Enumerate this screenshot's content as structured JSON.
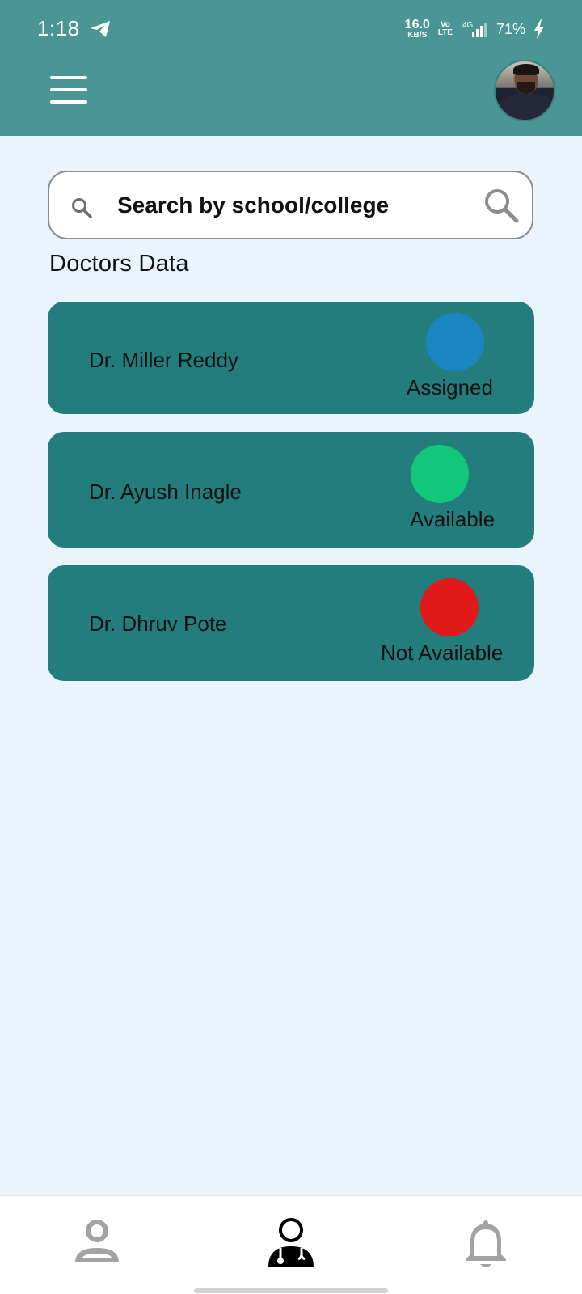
{
  "status_bar": {
    "time": "1:18",
    "speed_value": "16.0",
    "speed_unit": "KB/S",
    "volte_top": "Vo",
    "volte_bottom": "LTE",
    "network": "4G",
    "battery": "71%"
  },
  "search": {
    "placeholder": "Search by school/college"
  },
  "section_title": "Doctors Data",
  "doctors": [
    {
      "name": "Dr. Miller Reddy",
      "status": "Assigned",
      "status_color": "#1a87c2"
    },
    {
      "name": "Dr. Ayush Inagle",
      "status": "Available",
      "status_color": "#13c77a"
    },
    {
      "name": "Dr. Dhruv Pote",
      "status": "Not Available",
      "status_color": "#e01919"
    }
  ],
  "colors": {
    "header": "#4a9696",
    "card": "#247d7d",
    "background": "#eaf4fd"
  },
  "bottom_nav": [
    {
      "icon": "person-icon",
      "active": false
    },
    {
      "icon": "doctor-icon",
      "active": true
    },
    {
      "icon": "bell-icon",
      "active": false
    }
  ]
}
